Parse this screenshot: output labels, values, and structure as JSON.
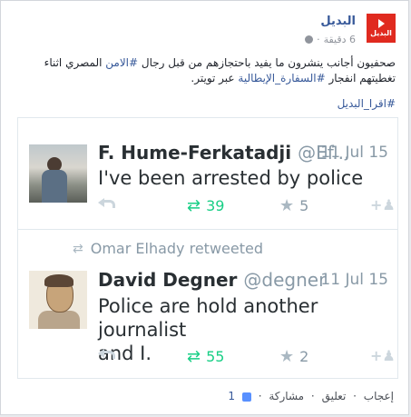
{
  "post": {
    "page_name": "البديل",
    "time": "6 دقيقة",
    "logo_text": "البديل",
    "text_part1": "صحفيون أجانب ينشرون ما يفيد باحتجازهم من قبل رجال ",
    "hashtag1": "#الامن",
    "text_part2": " المصري اثناء تغطيتهم انفجار ",
    "hashtag2": "#السفارة_الإيطالية",
    "text_part3": " عبر تويتر.",
    "hashtag3": "#اقرا_البديل"
  },
  "tweets": [
    {
      "name": "F. Hume-Ferkatadji",
      "handle": "@Ef...",
      "date": "11 Jul 15",
      "text": "I've been arrested by police",
      "retweets": "39",
      "favorites": "5"
    },
    {
      "retweeted_by": "Omar Elhady retweeted",
      "name": "David Degner",
      "handle": "@degner",
      "date": "11 Jul 15",
      "text_line1": "Police are hold another journalist",
      "text_line2": "and I.",
      "retweets": "55",
      "favorites": "2"
    }
  ],
  "footer": {
    "like": "إعجاب",
    "comment": "تعليق",
    "share": "مشاركة",
    "like_count": "1",
    "sep": "·"
  },
  "colors": {
    "link": "#365899",
    "retweet": "#19cf86",
    "brand": "#e02a1f"
  }
}
